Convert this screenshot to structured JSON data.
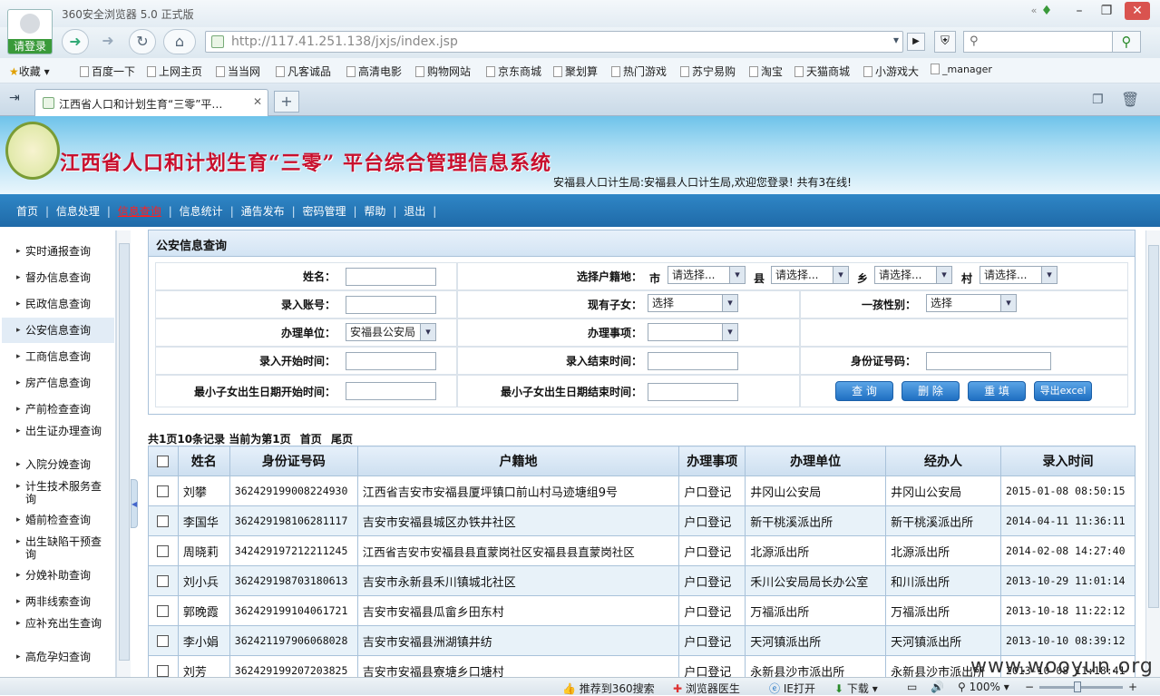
{
  "browser": {
    "title": "360安全浏览器 5.0 正式版",
    "login_label": "请登录",
    "url_host": "http://117.41.251.138",
    "url_path": "/jxjs/index.jsp",
    "tab_title": "江西省人口和计划生育“三零”平…",
    "favorites_label": "收藏",
    "favorites": [
      "百度一下",
      "上网主页",
      "当当网",
      "凡客诚品",
      "高清电影",
      "购物网站",
      "京东商城",
      "聚划算",
      "热门游戏",
      "苏宁易购",
      "淘宝",
      "天猫商城",
      "小游戏大",
      "_manager"
    ]
  },
  "header": {
    "system_title": "江西省人口和计划生育“三零”  平台综合管理信息系统",
    "welcome": "安福县人口计生局:安福县人口计生局,欢迎您登录!   共有3在线!"
  },
  "menu": {
    "items": [
      "首页",
      "信息处理",
      "信息查询",
      "信息统计",
      "通告发布",
      "密码管理",
      "帮助",
      "退出"
    ],
    "active": "信息查询"
  },
  "sidebar": {
    "items": [
      "实时通报查询",
      "督办信息查询",
      "民政信息查询",
      "公安信息查询",
      "工商信息查询",
      "房产信息查询",
      "产前检查查询",
      "出生证办理查询",
      "入院分娩查询",
      "计生技术服务查询",
      "婚前检查查询",
      "出生缺陷干预查询",
      "分娩补助查询",
      "两非线索查询",
      "应补充出生查询",
      "高危孕妇查询"
    ],
    "active": "公安信息查询"
  },
  "panel": {
    "title": "公安信息查询"
  },
  "form": {
    "name_label": "姓名：",
    "huji_label": "选择户籍地：",
    "city_label": "市",
    "county_label": "县",
    "township_label": "乡",
    "village_label": "村",
    "select_placeholder": "请选择...",
    "account_label": "录入账号：",
    "children_label": "现有子女：",
    "children_value": "选择",
    "first_child_gender_label": "一孩性别：",
    "first_child_gender_value": "选择",
    "unit_label": "办理单位：",
    "unit_value": "安福县公安局",
    "matter_label": "办理事项：",
    "start_time_label": "录入开始时间：",
    "end_time_label": "录入结束时间：",
    "id_label": "身份证号码：",
    "youngest_start_label": "最小子女出生日期开始时间：",
    "youngest_end_label": "最小子女出生日期结束时间：",
    "query_btn": "查 询",
    "delete_btn": "删 除",
    "reset_btn": "重 填",
    "export_btn": "导出excel"
  },
  "pager": {
    "summary": "共1页10条记录 当前为第1页",
    "first": "首页",
    "last": "尾页"
  },
  "table": {
    "headers": [
      "姓名",
      "身份证号码",
      "户籍地",
      "办理事项",
      "办理单位",
      "经办人",
      "录入时间"
    ],
    "rows": [
      [
        "刘攀",
        "362429199008224930",
        "江西省吉安市安福县厦坪镇口前山村马迹塘组9号",
        "户口登记",
        "井冈山公安局",
        "井冈山公安局",
        "2015-01-08 08:50:15"
      ],
      [
        "李国华",
        "362429198106281117",
        "吉安市安福县城区办铁井社区",
        "户口登记",
        "新干桃溪派出所",
        "新干桃溪派出所",
        "2014-04-11 11:36:11"
      ],
      [
        "周晓莉",
        "342429197212211245",
        "江西省吉安市安福县县直蒙岗社区安福县县直蒙岗社区",
        "户口登记",
        "北源派出所",
        "北源派出所",
        "2014-02-08 14:27:40"
      ],
      [
        "刘小兵",
        "362429198703180613",
        "吉安市永新县禾川镇城北社区",
        "户口登记",
        "禾川公安局局长办公室",
        "和川派出所",
        "2013-10-29 11:01:14"
      ],
      [
        "郭晚霞",
        "362429199104061721",
        "吉安市安福县瓜畲乡田东村",
        "户口登记",
        "万福派出所",
        "万福派出所",
        "2013-10-18 11:22:12"
      ],
      [
        "李小娟",
        "362421197906068028",
        "吉安市安福县洲湖镇井纺",
        "户口登记",
        "天河镇派出所",
        "天河镇派出所",
        "2013-10-10 08:39:12"
      ],
      [
        "刘芳",
        "362429199207203825",
        "吉安市安福县寮塘乡口塘村",
        "户口登记",
        "永新县沙市派出所",
        "永新县沙市派出所",
        "2013-10-08 11:18:41"
      ]
    ]
  },
  "statusbar": {
    "items": [
      "推荐到360搜索",
      "浏览器医生",
      "IE打开",
      "下载"
    ],
    "zoom": "100%"
  },
  "watermark": "www.wooyun.org"
}
